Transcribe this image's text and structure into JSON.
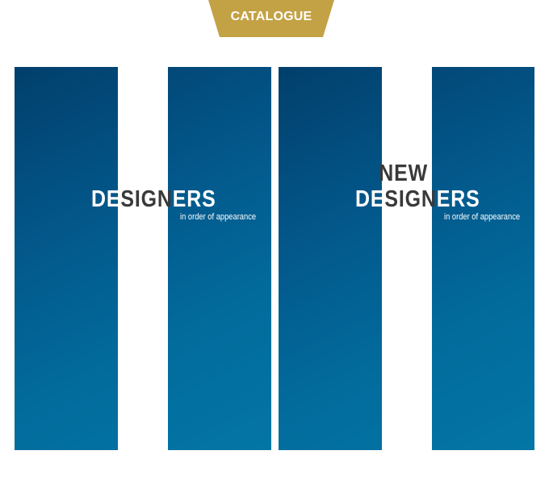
{
  "tab": {
    "label": "CATALOGUE",
    "color": "#c3a245"
  },
  "covers": [
    {
      "title_lines": [
        {
          "left": "DE",
          "middle": "SIGN",
          "right": "ERS"
        }
      ],
      "subtitle": "in order of appearance"
    },
    {
      "title_lines": [
        {
          "left": "",
          "middle": "NEW",
          "right": ""
        },
        {
          "left": "DE",
          "middle": "SIGN",
          "right": "ERS"
        }
      ],
      "subtitle": "in order of appearance"
    }
  ],
  "colors": {
    "cover_dark": "#013f6c",
    "cover_light": "#0376a6",
    "title_dark": "#3a3a3a",
    "stripe": "#ffffff"
  }
}
